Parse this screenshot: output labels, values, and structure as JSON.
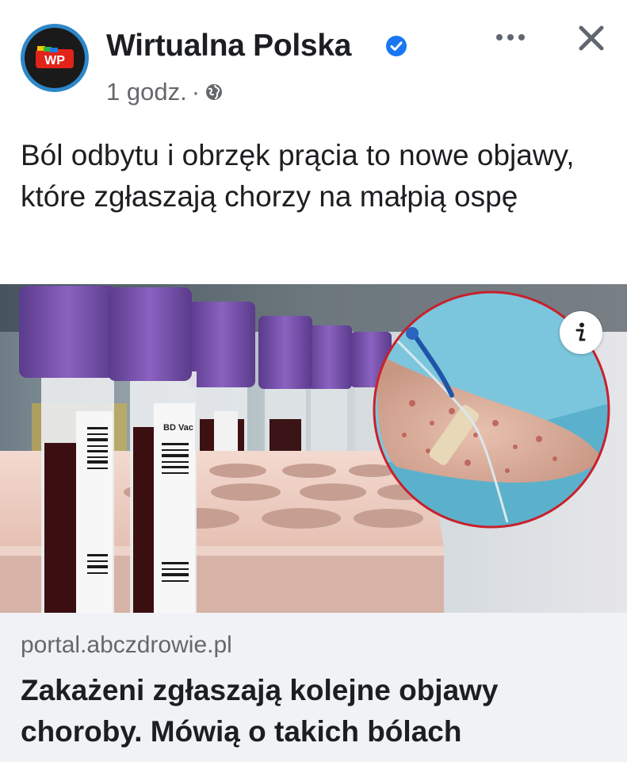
{
  "post": {
    "page_name": "Wirtualna Polska",
    "avatar_text": "WP",
    "time": "1 godz.",
    "separator": "·",
    "caption": "Ból odbytu i obrzęk prącia to nowe objawy, które zgłaszają chorzy na małpią ospę"
  },
  "icons": {
    "verified": "verified-badge-icon",
    "privacy": "globe-icon",
    "more": "more-options-icon",
    "close": "close-icon",
    "info": "info-icon"
  },
  "media": {
    "tube_label": "BD Vac"
  },
  "link_preview": {
    "domain": "portal.abczdrowie.pl",
    "headline": "Zakażeni zgłaszają kolejne objawy choroby. Mówią o takich bólach"
  },
  "colors": {
    "verified_blue": "#1877f2",
    "avatar_ring": "#2d88c8",
    "wp_red": "#e2231a",
    "tube_cap_purple": "#7d4fb0",
    "link_bg": "#f0f2f5"
  }
}
